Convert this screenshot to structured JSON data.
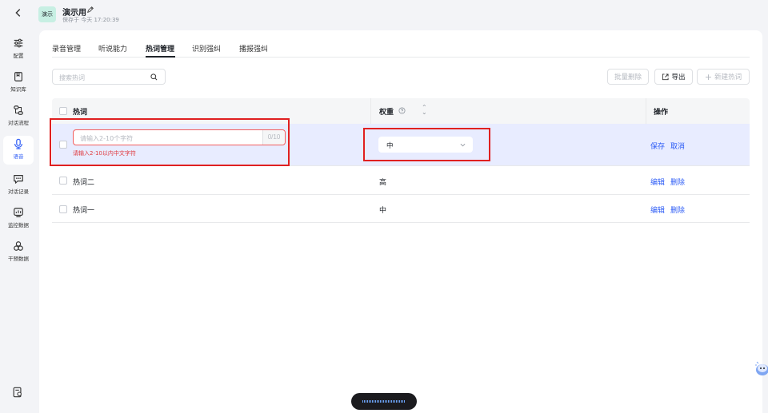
{
  "header": {
    "badge": "演示",
    "title": "演示用",
    "save_time": "保存于 今天 17:20:39"
  },
  "sidebar": {
    "items": [
      {
        "label": "配置",
        "icon": "sliders-icon"
      },
      {
        "label": "知识库",
        "icon": "book-icon"
      },
      {
        "label": "对话流程",
        "icon": "flow-icon"
      },
      {
        "label": "语音",
        "icon": "microphone-icon",
        "active": true
      },
      {
        "label": "对话记录",
        "icon": "chat-icon"
      },
      {
        "label": "监控数据",
        "icon": "monitor-icon"
      },
      {
        "label": "干预数据",
        "icon": "intervene-icon"
      }
    ]
  },
  "tabs": [
    "录音管理",
    "听说能力",
    "热词管理",
    "识别强纠",
    "播报强纠"
  ],
  "active_tab": "热词管理",
  "toolbar": {
    "search_placeholder": "搜索热词",
    "batch_delete": "批量删除",
    "export": "导出",
    "new_hotword": "新建热词"
  },
  "table": {
    "headers": {
      "hotword": "热词",
      "weight": "权重",
      "actions": "操作"
    },
    "editing_row": {
      "input_placeholder": "请输入2-10个字符",
      "char_count": "0/10",
      "error": "请输入2-10以内中文字符",
      "weight": "中",
      "save": "保存",
      "cancel": "取消"
    },
    "rows": [
      {
        "hotword": "热词二",
        "weight": "高",
        "edit": "编辑",
        "delete": "删除"
      },
      {
        "hotword": "热词一",
        "weight": "中",
        "edit": "编辑",
        "delete": "删除"
      }
    ]
  },
  "colors": {
    "accent": "#2d5cf6",
    "error": "#e0393e",
    "editing_row_bg": "#e8ecff",
    "highlight_box": "#e02020"
  }
}
